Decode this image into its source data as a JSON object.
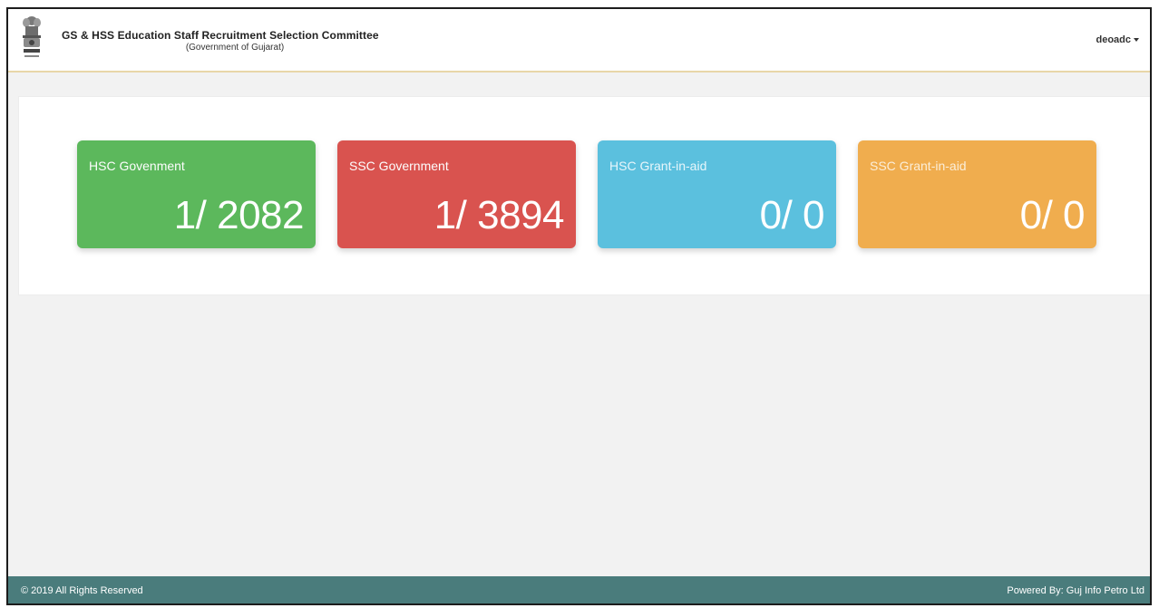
{
  "header": {
    "title": "GS & HSS Education Staff Recruitment Selection Committee",
    "subtitle": "(Government of Gujarat)",
    "user": "deoadc"
  },
  "cards": [
    {
      "label": "HSC Govenment",
      "value": "1/ 2082",
      "color": "#5cb85c"
    },
    {
      "label": "SSC Government",
      "value": "1/ 3894",
      "color": "#d9534f"
    },
    {
      "label": "HSC Grant-in-aid",
      "value": "0/ 0",
      "color": "#5bc0de"
    },
    {
      "label": "SSC Grant-in-aid",
      "value": "0/ 0",
      "color": "#f0ad4e"
    }
  ],
  "footer": {
    "copyright": "© 2019 All Rights Reserved",
    "powered_by": "Powered By: Guj Info Petro Ltd"
  },
  "colors": {
    "footer_bg": "#4a7c7c",
    "header_border": "#e8d6a8"
  }
}
